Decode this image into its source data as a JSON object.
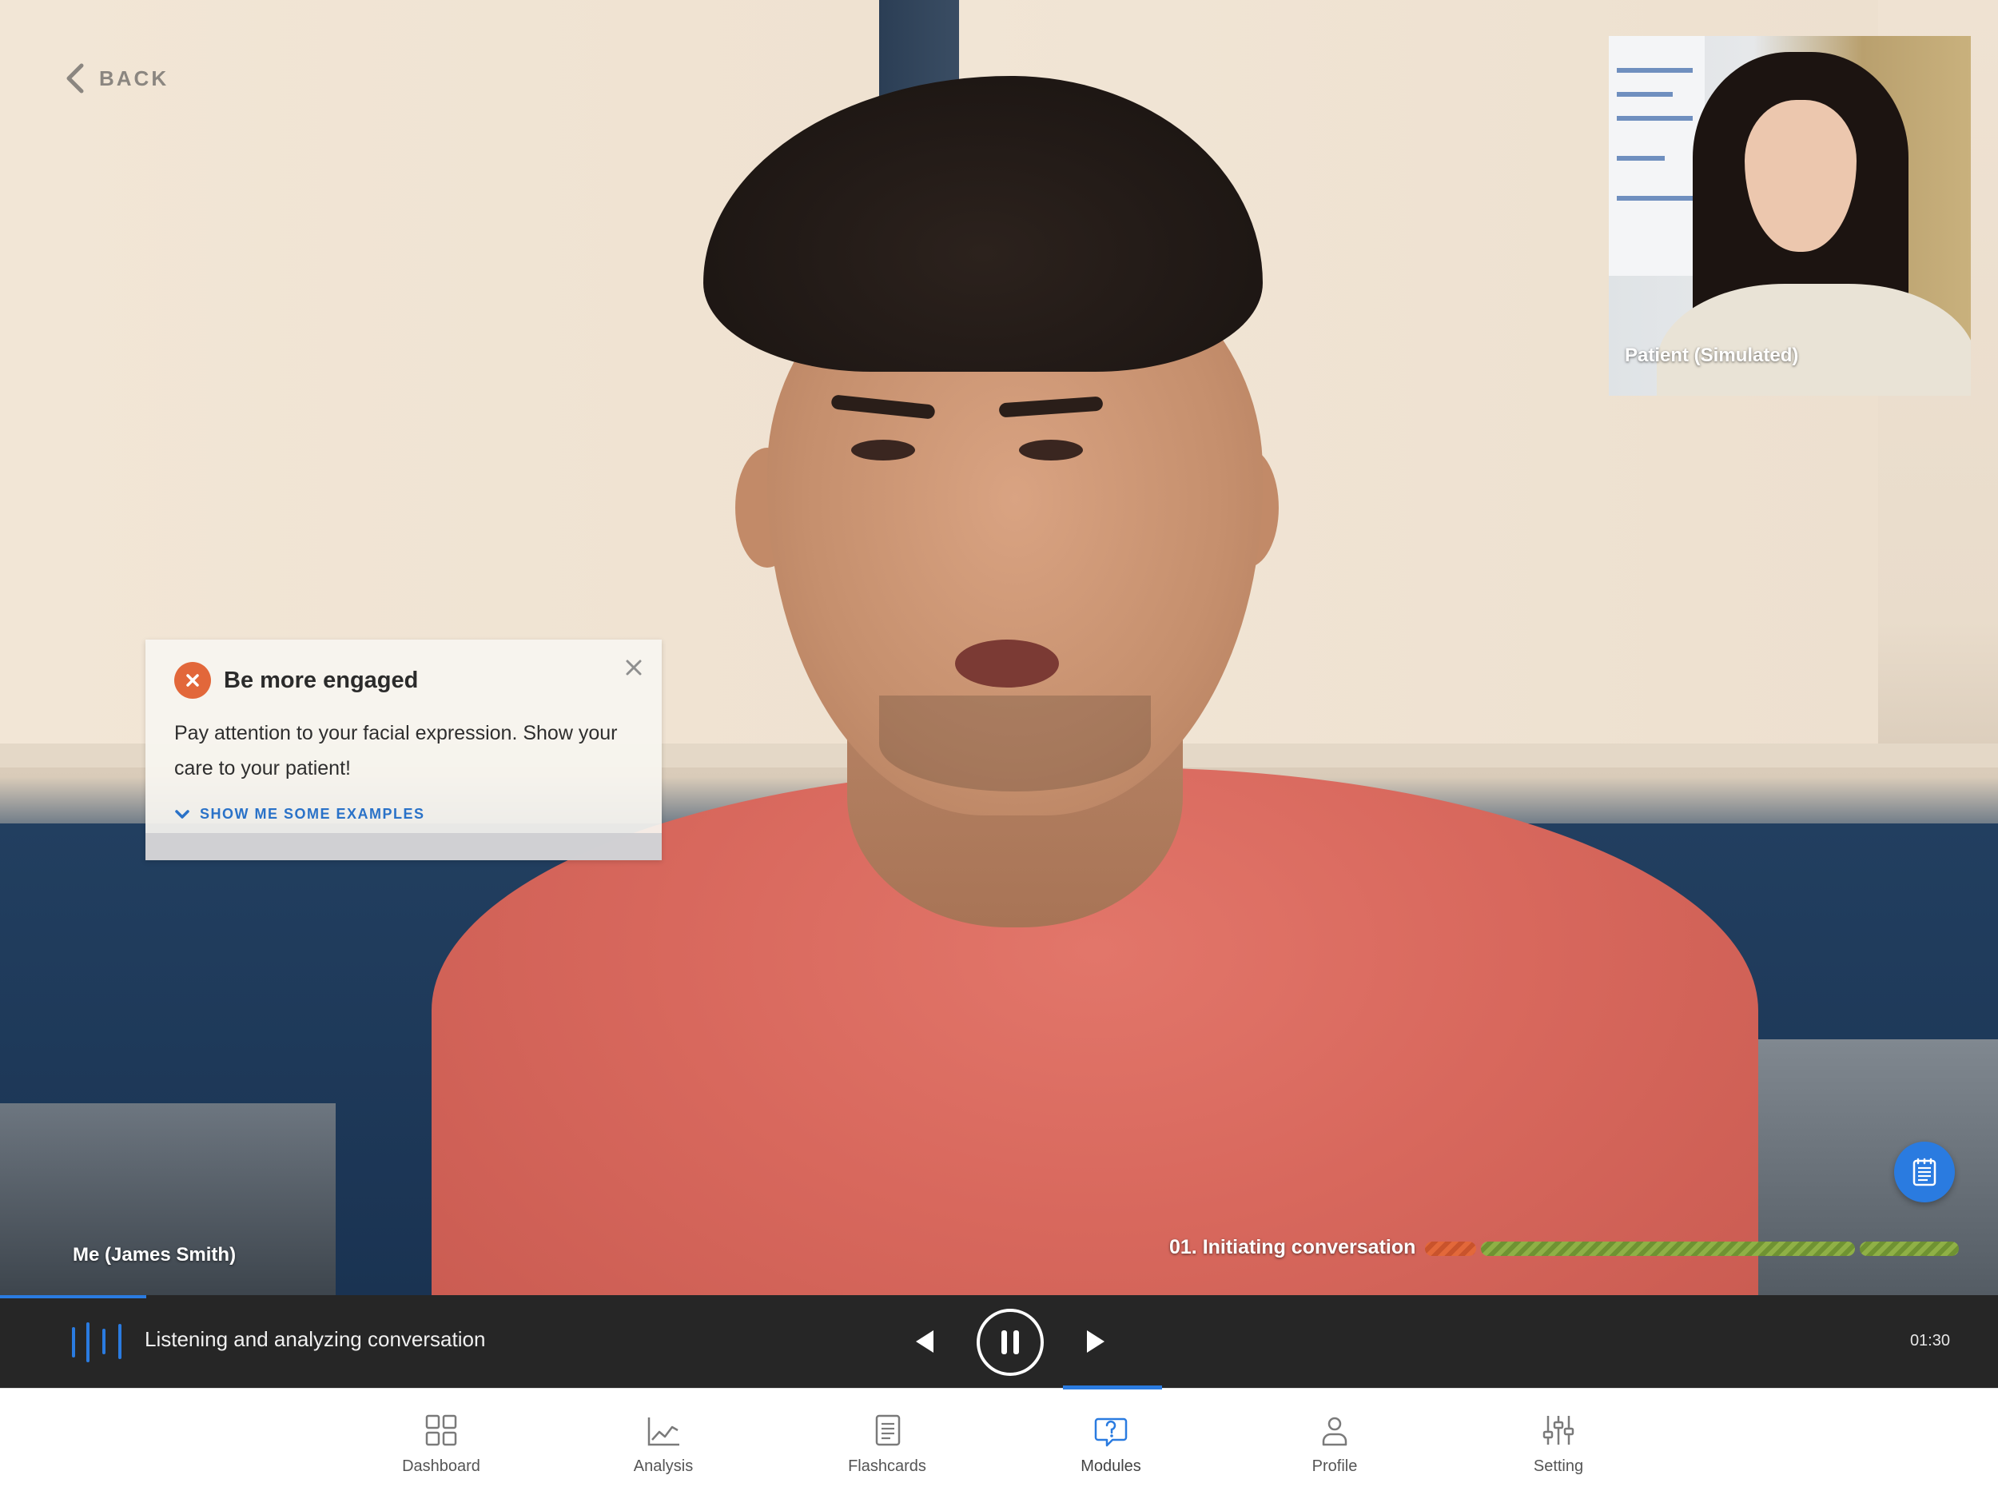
{
  "nav": {
    "back_label": "BACK"
  },
  "video": {
    "main_participant_label": "Me (James Smith)",
    "remote_participant_label": "Patient (Simulated)"
  },
  "feedback": {
    "title": "Be more engaged",
    "body": "Pay attention to your facial expression. Show your care to your patient!",
    "link_label": "SHOW ME SOME EXAMPLES"
  },
  "section": {
    "label": "01. Initiating conversation",
    "segments": [
      {
        "status": "needs-work",
        "color": "#e3683a"
      },
      {
        "status": "good",
        "color": "#8fb046"
      },
      {
        "status": "good",
        "color": "#8fb046"
      }
    ]
  },
  "player": {
    "status_text": "Listening and analyzing conversation",
    "time": "01:30",
    "progress_fraction": 0.073
  },
  "tabs": [
    {
      "label": "Dashboard",
      "icon": "grid-icon",
      "active": false
    },
    {
      "label": "Analysis",
      "icon": "line-chart-icon",
      "active": false
    },
    {
      "label": "Flashcards",
      "icon": "cards-icon",
      "active": false
    },
    {
      "label": "Modules",
      "icon": "chat-question-icon",
      "active": true
    },
    {
      "label": "Profile",
      "icon": "person-icon",
      "active": false
    },
    {
      "label": "Setting",
      "icon": "sliders-icon",
      "active": false
    }
  ],
  "colors": {
    "accent": "#2a7be0",
    "warning": "#e2673a",
    "success": "#8fb046",
    "player_bg": "#262626"
  }
}
